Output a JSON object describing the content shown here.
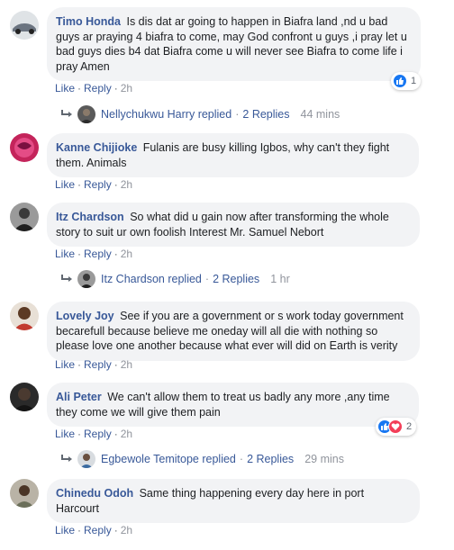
{
  "actions": {
    "like": "Like",
    "reply": "Reply",
    "separator": "·"
  },
  "comments": [
    {
      "author": "Timo Honda",
      "text": "Is dis dat ar going to happen in Biafra land ,nd u bad guys ar praying 4 biafra to come, may God confront u guys ,i pray let u bad guys dies b4 dat Biafra come u will never see Biafra to come life i pray Amen",
      "time": "2h",
      "reaction_count": "1",
      "replies": {
        "name": "Nellychukwu Harry",
        "replied": "replied",
        "count": "2 Replies",
        "time": "44 mins"
      }
    },
    {
      "author": "Kanne Chijioke",
      "text": "Fulanis are busy killing Igbos, why can't they fight them. Animals",
      "time": "2h"
    },
    {
      "author": "Itz Chardson",
      "text": "So what did u gain now after transforming the whole story to suit ur own foolish Interest Mr. Samuel Nebort",
      "time": "2h",
      "replies": {
        "name": "Itz Chardson",
        "replied": "replied",
        "count": "2 Replies",
        "time": "1 hr"
      }
    },
    {
      "author": "Lovely Joy",
      "text": "See if you are a government or s work today government becarefull because believe me oneday will all die with nothing so please love one another because what ever will did on Earth is verity",
      "time": "2h"
    },
    {
      "author": "Ali Peter",
      "text": "We can't allow them to treat us badly any more ,any time they come we will give them pain",
      "time": "2h",
      "reaction_count": "2",
      "replies": {
        "name": "Egbewole Temitope",
        "replied": "replied",
        "count": "2 Replies",
        "time": "29 mins"
      }
    },
    {
      "author": "Chinedu Odoh",
      "text": "Same thing happening every day here in port Harcourt",
      "time": "2h"
    }
  ]
}
